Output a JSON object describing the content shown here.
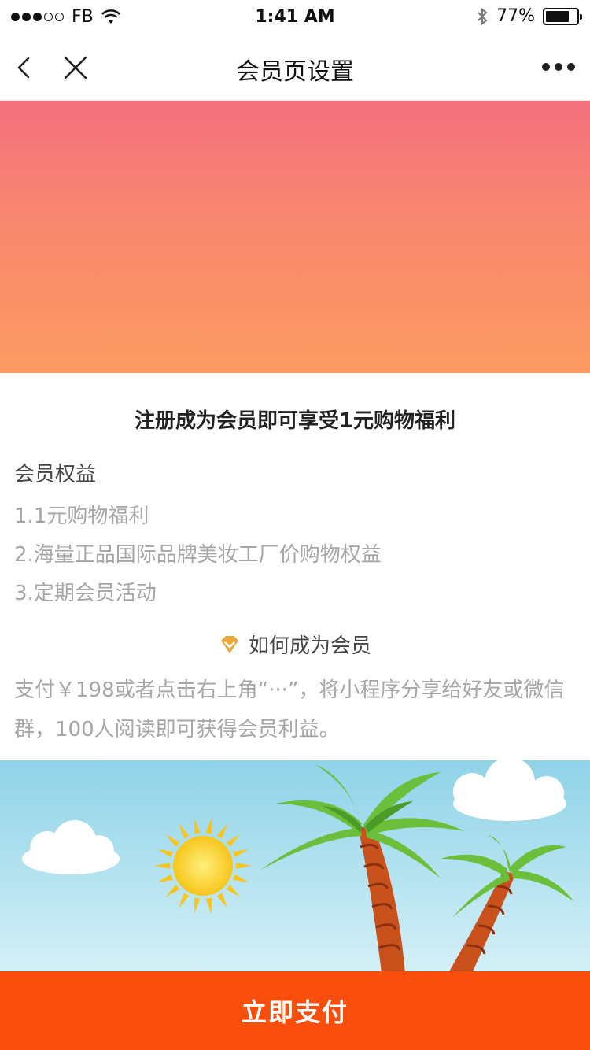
{
  "status_bar": {
    "carrier": "FB",
    "time": "1:41 AM",
    "battery_percent": "77%",
    "battery_level": 0.77,
    "signal_bars_filled": 3,
    "signal_bars_total": 5
  },
  "nav": {
    "title": "会员页设置",
    "back_icon": "chevron-left-icon",
    "close_icon": "close-icon",
    "more_icon": "more-dots-icon"
  },
  "content": {
    "headline": "注册成为会员即可享受1元购物福利",
    "benefits_title": "会员权益",
    "benefits": [
      "1.1元购物福利",
      "2.海量正品国际品牌美妆工厂价购物权益",
      "3.定期会员活动"
    ],
    "how_title": "如何成为会员",
    "how_description": "支付￥198或者点击右上角“···”，将小程序分享给好友或微信群，100人阅读即可获得会员利益。"
  },
  "colors": {
    "banner_top": "#f4707e",
    "banner_bottom": "#fc9a62",
    "accent_orange": "#fa4f0c",
    "diamond_gold": "#e9a93a"
  },
  "pay_button": {
    "label": "立即支付"
  }
}
